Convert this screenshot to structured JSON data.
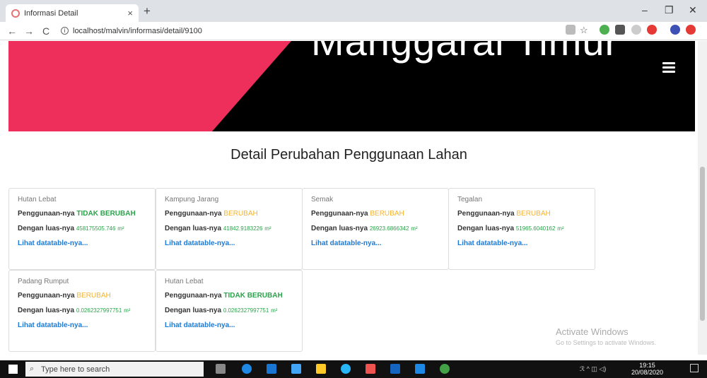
{
  "browser": {
    "tab_title": "Informasi Detail",
    "tab_close": "×",
    "new_tab": "+",
    "url": "localhost/malvin/informasi/detail/9100",
    "back": "←",
    "forward": "→",
    "reload": "C",
    "info": "i",
    "minimize": "–",
    "maximize": "❐",
    "close": "✕"
  },
  "hero": {
    "title": "Manggarai Timur"
  },
  "page": {
    "heading": "Detail Perubahan Penggunaan Lahan"
  },
  "cards": [
    {
      "name": "Hutan Lebat",
      "use_label": "Penggunaan-nya",
      "status": "TIDAK BERUBAH",
      "area_label": "Dengan luas-nya",
      "area": "458175505.746",
      "unit": "m²",
      "link": "Lihat datatable-nya..."
    },
    {
      "name": "Kampung Jarang",
      "use_label": "Penggunaan-nya",
      "status": "BERUBAH",
      "area_label": "Dengan luas-nya",
      "area": "41842.9183226",
      "unit": "m²",
      "link": "Lihat datatable-nya..."
    },
    {
      "name": "Semak",
      "use_label": "Penggunaan-nya",
      "status": "BERUBAH",
      "area_label": "Dengan luas-nya",
      "area": "26923.6866342",
      "unit": "m²",
      "link": "Lihat datatable-nya..."
    },
    {
      "name": "Tegalan",
      "use_label": "Penggunaan-nya",
      "status": "BERUBAH",
      "area_label": "Dengan luas-nya",
      "area": "51965.6040162",
      "unit": "m²",
      "link": "Lihat datatable-nya..."
    },
    {
      "name": "Padang Rumput",
      "use_label": "Penggunaan-nya",
      "status": "BERUBAH",
      "area_label": "Dengan luas-nya",
      "area": "0.0262327997751",
      "unit": "m²",
      "link": "Lihat datatable-nya..."
    },
    {
      "name": "Hutan Lebat",
      "use_label": "Penggunaan-nya",
      "status": "TIDAK BERUBAH",
      "area_label": "Dengan luas-nya",
      "area": "0.0262327997751",
      "unit": "m²",
      "link": "Lihat datatable-nya..."
    }
  ],
  "watermark": {
    "line1": "Activate Windows",
    "line2": "Go to Settings to activate Windows."
  },
  "taskbar": {
    "search_placeholder": "Type here to search",
    "time": "19:15",
    "date": "20/08/2020"
  },
  "colors": {
    "brand_pink": "#ee2f5b",
    "changed": "#f5b32b",
    "unchanged": "#2aa34a",
    "link": "#1e7ad4"
  }
}
